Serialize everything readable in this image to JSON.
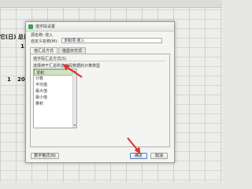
{
  "spreadsheet": {
    "header_text": "它(日) 总计",
    "row_value_1": "1",
    "row_value_2": "1",
    "row_value_3": "20"
  },
  "dialog": {
    "title": "值字段设置",
    "source_name_label": "源名称: 收入",
    "custom_name_label": "自定义名称(M):",
    "custom_name_value": "求和项:收入",
    "tabs": [
      {
        "label": "值汇总方式"
      },
      {
        "label": "值显示方式"
      }
    ],
    "group_title": "值字段汇总方式(S)",
    "hint": "选择用于汇总所选字段数据的计算类型",
    "functions": [
      "求和",
      "计数",
      "平均值",
      "最大值",
      "最小值",
      "乘积"
    ],
    "selected_function": "求和",
    "number_format_button": "数字格式(N)",
    "ok_button": "确定",
    "cancel_button": "取消"
  },
  "colors": {
    "selection": "#cfe3c4",
    "annotation_arrow": "#e0302a",
    "app_icon": "#3aa35b"
  }
}
